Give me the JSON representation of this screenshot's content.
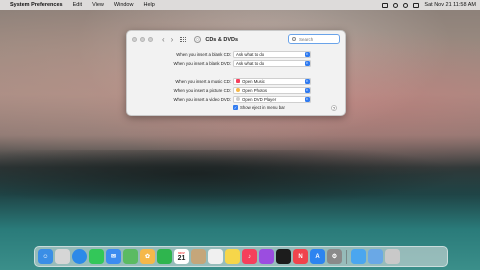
{
  "menubar": {
    "app_name": "System Preferences",
    "items": [
      "Edit",
      "View",
      "Window",
      "Help"
    ],
    "datetime": "Sat Nov 21  11:58 AM"
  },
  "window": {
    "title": "CDs & DVDs",
    "search_placeholder": "Search",
    "rows": [
      {
        "label": "When you insert a blank CD:",
        "value": "Ask what to do"
      },
      {
        "label": "When you insert a blank DVD:",
        "value": "Ask what to do"
      },
      {
        "label": "When you insert a music CD:",
        "value": "Open Music"
      },
      {
        "label": "When you insert a picture CD:",
        "value": "Open Photos"
      },
      {
        "label": "When you insert a video DVD:",
        "value": "Open DVD Player"
      }
    ],
    "checkbox_label": "Show eject in menu bar",
    "help": "?"
  },
  "dock": {
    "calendar_month": "NOV",
    "calendar_day": "21",
    "items": [
      {
        "name": "finder",
        "color": "#3a8ee6"
      },
      {
        "name": "launchpad",
        "color": "#d6d6d6"
      },
      {
        "name": "safari",
        "color": "#2c8ae8"
      },
      {
        "name": "messages",
        "color": "#33c759"
      },
      {
        "name": "mail",
        "color": "#3d8cf0"
      },
      {
        "name": "maps",
        "color": "#5bbb62"
      },
      {
        "name": "photos",
        "color": "#f5b84a"
      },
      {
        "name": "facetime",
        "color": "#2fb54e"
      },
      {
        "name": "calendar",
        "color": "#ffffff"
      },
      {
        "name": "contacts",
        "color": "#c5a67a"
      },
      {
        "name": "reminders",
        "color": "#f0f0f0"
      },
      {
        "name": "notes",
        "color": "#f6d64a"
      },
      {
        "name": "music",
        "color": "#f5405c"
      },
      {
        "name": "podcasts",
        "color": "#9b4de0"
      },
      {
        "name": "tv",
        "color": "#1c1c1c"
      },
      {
        "name": "news",
        "color": "#f0434c"
      },
      {
        "name": "appstore",
        "color": "#2d84f0"
      },
      {
        "name": "system-preferences",
        "color": "#8a8a8a"
      },
      {
        "name": "airdrop",
        "color": "#4aa6ef"
      },
      {
        "name": "downloads",
        "color": "#6aa8e6"
      },
      {
        "name": "trash",
        "color": "#c9c9c9"
      }
    ]
  }
}
